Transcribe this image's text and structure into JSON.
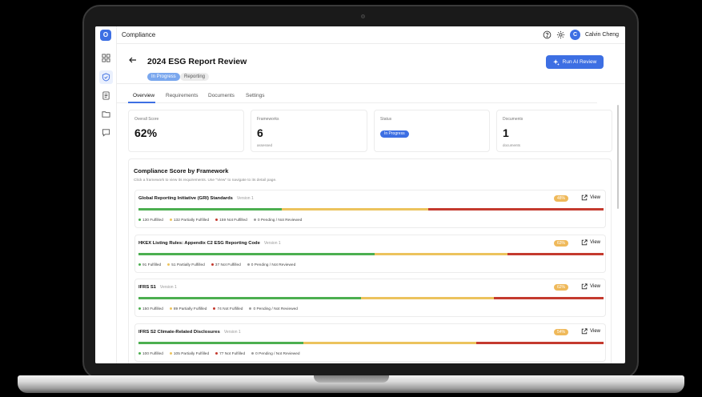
{
  "app": {
    "title": "Compliance",
    "logo_letter": "O"
  },
  "user": {
    "initial": "C",
    "name": "Calvin Cheng"
  },
  "page": {
    "title": "2024 ESG Report Review",
    "status_badge": "In Progress",
    "category_badge": "Reporting",
    "run_button": "Run AI Review"
  },
  "tabs": [
    "Overview",
    "Requirements",
    "Documents",
    "Settings"
  ],
  "stats": [
    {
      "label": "Overall Score",
      "value": "62%",
      "sub": ""
    },
    {
      "label": "Frameworks",
      "value": "6",
      "sub": "assessed"
    },
    {
      "label": "Status",
      "value": "In Progress",
      "sub": ""
    },
    {
      "label": "Documents",
      "value": "1",
      "sub": "documents"
    }
  ],
  "score_section": {
    "title": "Compliance Score by Framework",
    "subtitle": "Click a framework to view its requirements. Use \"View\" to navigate to its detail page."
  },
  "view_label": "View",
  "colors": {
    "accent": "#3d6fe3",
    "fulfilled": "#4caf50",
    "partial": "#ecc35d",
    "not_fulfilled": "#c43a2e",
    "pending": "#9e9e9e"
  },
  "frameworks": [
    {
      "name": "Global Reporting Initiative (GRI) Standards",
      "version": "Version 1",
      "score": "48%",
      "counts": {
        "fulfilled": 130,
        "partial": 132,
        "not": 159,
        "pending": 0
      },
      "legend": [
        "130 Fulfilled",
        "132 Partially Fulfilled",
        "159 Not Fulfilled",
        "0 Pending / Not Reviewed"
      ]
    },
    {
      "name": "HKEX Listing Rules: Appendix C2 ESG Reporting Code",
      "version": "Version 1",
      "score": "63%",
      "counts": {
        "fulfilled": 91,
        "partial": 51,
        "not": 37,
        "pending": 0
      },
      "legend": [
        "91 Fulfilled",
        "51 Partially Fulfilled",
        "37 Not Fulfilled",
        "0 Pending / Not Reviewed"
      ]
    },
    {
      "name": "IFRS S1",
      "version": "Version 1",
      "score": "62%",
      "counts": {
        "fulfilled": 150,
        "partial": 89,
        "not": 74,
        "pending": 0
      },
      "legend": [
        "150 Fulfilled",
        "89 Partially Fulfilled",
        "74 Not Fulfilled",
        "0 Pending / Not Reviewed"
      ]
    },
    {
      "name": "IFRS S2 Climate-Related Disclosures",
      "version": "Version 1",
      "score": "54%",
      "counts": {
        "fulfilled": 100,
        "partial": 105,
        "not": 77,
        "pending": 0
      },
      "legend": [
        "100 Fulfilled",
        "105 Partially Fulfilled",
        "77 Not Fulfilled",
        "0 Pending / Not Reviewed"
      ]
    }
  ]
}
